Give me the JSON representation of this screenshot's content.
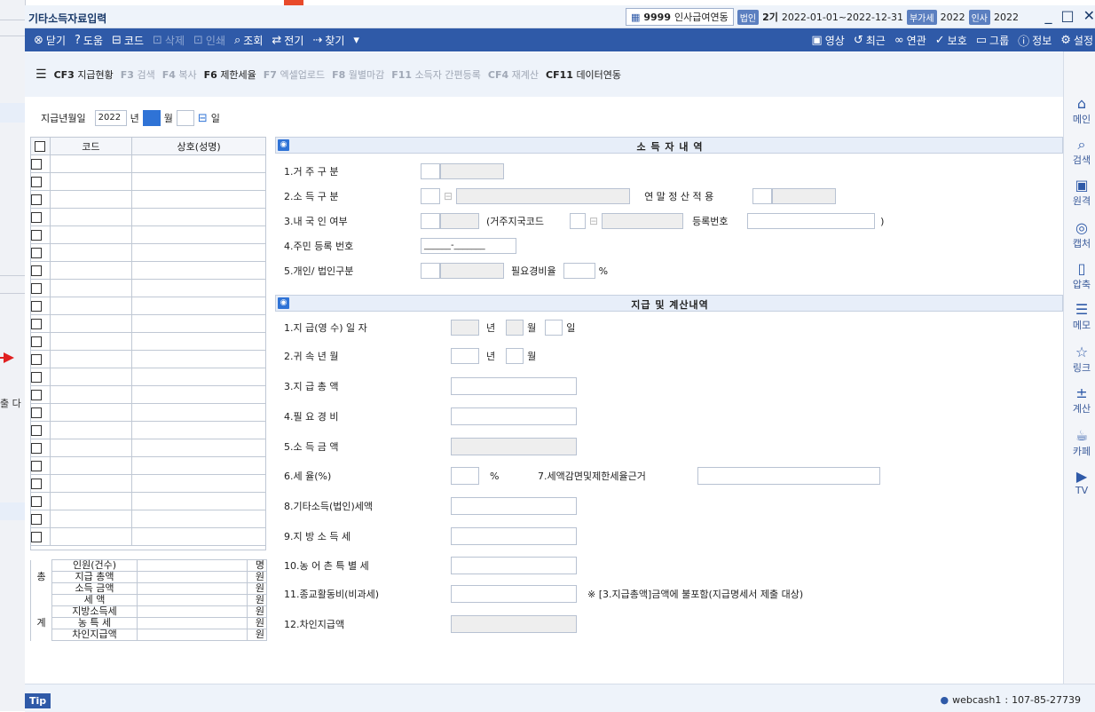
{
  "window": {
    "title": "기타소득자료입력",
    "company_code": "9999",
    "company_name": "인사급여연동",
    "badge_corp": "법인",
    "period_label": "2기",
    "period_range": "2022-01-01~2022-12-31",
    "badge_vat": "부가세",
    "vat_year": "2022",
    "badge_hr": "인사",
    "hr_year": "2022",
    "minimize": "_",
    "maximize": "□",
    "close": "✕"
  },
  "toolbar": {
    "left": [
      {
        "icon": "close-circle-icon",
        "glyph": "⊗",
        "label": "닫기",
        "enabled": true
      },
      {
        "icon": "help-icon",
        "glyph": "?",
        "label": "도움",
        "enabled": true
      },
      {
        "icon": "code-icon",
        "glyph": "⊟",
        "label": "코드",
        "enabled": true
      },
      {
        "icon": "delete-icon",
        "glyph": "⊡",
        "label": "삭제",
        "enabled": false
      },
      {
        "icon": "print-icon",
        "glyph": "⊡",
        "label": "인쇄",
        "enabled": false
      },
      {
        "icon": "search-icon",
        "glyph": "⌕",
        "label": "조회",
        "enabled": true
      },
      {
        "icon": "transfer-icon",
        "glyph": "⇄",
        "label": "전기",
        "enabled": true
      },
      {
        "icon": "find-icon",
        "glyph": "⇢",
        "label": "찾기",
        "enabled": true
      },
      {
        "icon": "dropdown-icon",
        "glyph": "▾",
        "label": "",
        "enabled": true
      }
    ],
    "right": [
      {
        "icon": "video-icon",
        "glyph": "▣",
        "label": "영상"
      },
      {
        "icon": "recent-icon",
        "glyph": "↺",
        "label": "최근"
      },
      {
        "icon": "related-icon",
        "glyph": "∞",
        "label": "연관"
      },
      {
        "icon": "protect-icon",
        "glyph": "✓",
        "label": "보호"
      },
      {
        "icon": "group-icon",
        "glyph": "▭",
        "label": "그룹"
      },
      {
        "icon": "info-icon",
        "glyph": "ⓘ",
        "label": "정보"
      },
      {
        "icon": "settings-icon",
        "glyph": "⚙",
        "label": "설정"
      }
    ]
  },
  "fkeys": [
    {
      "key": "CF3",
      "label": "지급현황",
      "enabled": true
    },
    {
      "key": "F3",
      "label": "검색",
      "enabled": false
    },
    {
      "key": "F4",
      "label": "복사",
      "enabled": false
    },
    {
      "key": "F6",
      "label": "제한세율",
      "enabled": true
    },
    {
      "key": "F7",
      "label": "엑셀업로드",
      "enabled": false
    },
    {
      "key": "F8",
      "label": "월별마감",
      "enabled": false
    },
    {
      "key": "F11",
      "label": "소득자 간편등록",
      "enabled": false
    },
    {
      "key": "CF4",
      "label": "재계산",
      "enabled": false
    },
    {
      "key": "CF11",
      "label": "데이터연동",
      "enabled": true
    }
  ],
  "date": {
    "label": "지급년월일",
    "year": "2022",
    "year_unit": "년",
    "month_unit": "월",
    "day_unit": "일"
  },
  "code_table": {
    "col_code": "코드",
    "col_name": "상호(성명)",
    "row_count": 22
  },
  "summary": {
    "side_top": "총",
    "side_bottom": "계",
    "rows": [
      {
        "label": "인원(건수)",
        "unit": "명"
      },
      {
        "label": "지급 총액",
        "unit": "원"
      },
      {
        "label": "소득 금액",
        "unit": "원"
      },
      {
        "label": "세      액",
        "unit": "원"
      },
      {
        "label": "지방소득세",
        "unit": "원"
      },
      {
        "label": "농 특 세",
        "unit": "원"
      },
      {
        "label": "차인지급액",
        "unit": "원"
      }
    ]
  },
  "section1": {
    "title": "소 득 자 내 역",
    "resident": "1.거  주  구  분",
    "income_type": "2.소  득  구  분",
    "year_end": "연 말 정 산 적 용",
    "domestic": "3.내 국 인  여부",
    "country_code": "(거주지국코드",
    "reg_no_label": "등록번호",
    "close_paren": ")",
    "resident_no": "4.주민 등록 번호",
    "resident_no_value": "______-_______",
    "personal_corp": "5.개인/ 법인구분",
    "expense_rate": "필요경비율",
    "percent": "%"
  },
  "section2": {
    "title": "지급 및 계산내역",
    "pay_date": "1.지 급(영 수) 일 자",
    "attr_ym": "2.귀   속    년   월",
    "total_pay": "3.지    급    총    액",
    "expense": "4.필    요    경    비",
    "income": "5.소    득    금    액",
    "tax_rate": "6.세             율(%)",
    "tax_reduction": "7.세액감면및제한세율근거",
    "other_tax": "8.기타소득(법인)세액",
    "local_tax": "9.지  방  소  득  세",
    "rural_tax": "10.농 어 촌  특 별 세",
    "religious": "11.종교활동비(비과세)",
    "religious_note": "※ [3.지급총액]금액에 불포함(지급명세서 제출 대상)",
    "net_pay": "12.차인지급액",
    "year_unit": "년",
    "month_unit": "월",
    "day_unit": "일",
    "pct_unit": "%"
  },
  "sidebar": [
    {
      "icon": "home-icon",
      "glyph": "⌂",
      "label": "메인"
    },
    {
      "icon": "search-icon",
      "glyph": "⌕",
      "label": "검색"
    },
    {
      "icon": "remote-icon",
      "glyph": "▣",
      "label": "원격"
    },
    {
      "icon": "capture-icon",
      "glyph": "◎",
      "label": "캡처"
    },
    {
      "icon": "compress-icon",
      "glyph": "▯",
      "label": "압축"
    },
    {
      "icon": "memo-icon",
      "glyph": "☰",
      "label": "메모"
    },
    {
      "icon": "link-icon",
      "glyph": "☆",
      "label": "링크"
    },
    {
      "icon": "calculator-icon",
      "glyph": "±",
      "label": "계산"
    },
    {
      "icon": "cafe-icon",
      "glyph": "☕",
      "label": "카페"
    },
    {
      "icon": "tv-icon",
      "glyph": "▶",
      "label": "TV"
    }
  ],
  "status": {
    "tip": "Tip",
    "user": "webcash1",
    "sep": ":",
    "biz_no": "107-85-27739"
  },
  "background": {
    "left_text": "출 다"
  }
}
